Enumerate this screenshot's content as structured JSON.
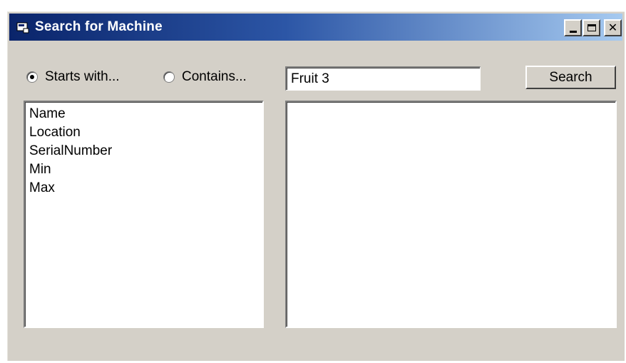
{
  "window": {
    "title": "Search for Machine"
  },
  "options": {
    "starts_with_label": "Starts with...",
    "contains_label": "Contains...",
    "selected": "starts_with"
  },
  "search": {
    "value": "Fruit 3",
    "button_label": "Search"
  },
  "fields": {
    "items": [
      "Name",
      "Location",
      "SerialNumber",
      "Min",
      "Max"
    ]
  },
  "results": {
    "items": []
  },
  "colors": {
    "face": "#d4d0c8",
    "title_start": "#0a246a",
    "title_end": "#a6caf0"
  }
}
